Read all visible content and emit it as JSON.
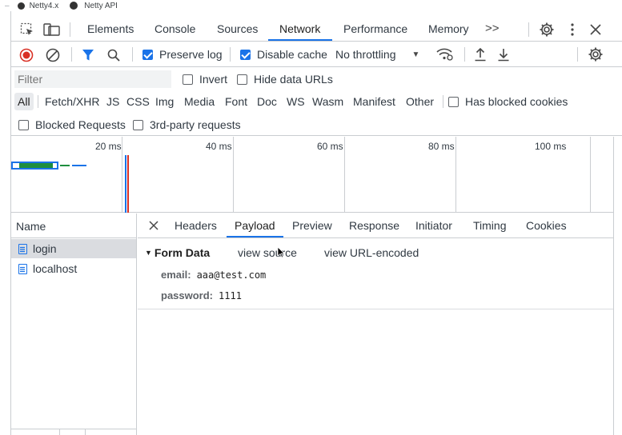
{
  "browser_tabs": [
    {
      "icon": "netty-icon",
      "label": "Netty4.x"
    },
    {
      "icon": "github-icon",
      "label": "Netty API"
    }
  ],
  "main_tabs": [
    "Elements",
    "Console",
    "Sources",
    "Network",
    "Performance",
    "Memory"
  ],
  "main_tabs_active": "Network",
  "more_tabs_glyph": ">>",
  "toolbar": {
    "preserve_log": "Preserve log",
    "disable_cache": "Disable cache",
    "throttling": "No throttling"
  },
  "filter": {
    "placeholder": "Filter",
    "invert": "Invert",
    "hide_data_urls": "Hide data URLs"
  },
  "type_filters": [
    "All",
    "Fetch/XHR",
    "JS",
    "CSS",
    "Img",
    "Media",
    "Font",
    "Doc",
    "WS",
    "Wasm",
    "Manifest",
    "Other"
  ],
  "has_blocked_cookies": "Has blocked cookies",
  "blocked_requests": "Blocked Requests",
  "third_party": "3rd-party requests",
  "timeline_ticks": [
    "20 ms",
    "40 ms",
    "60 ms",
    "80 ms",
    "100 ms"
  ],
  "name_column": "Name",
  "requests": [
    "login",
    "localhost"
  ],
  "detail_tabs": [
    "Headers",
    "Payload",
    "Preview",
    "Response",
    "Initiator",
    "Timing",
    "Cookies"
  ],
  "detail_tabs_active": "Payload",
  "payload": {
    "section_title": "Form Data",
    "view_source": "view source",
    "view_url_encoded": "view URL-encoded",
    "fields": [
      {
        "key": "email:",
        "value": "aaa@test.com"
      },
      {
        "key": "password:",
        "value": "1111"
      }
    ]
  },
  "colors": {
    "accent": "#1a73e8",
    "record_red": "#d93025",
    "border": "#cacdd1"
  }
}
